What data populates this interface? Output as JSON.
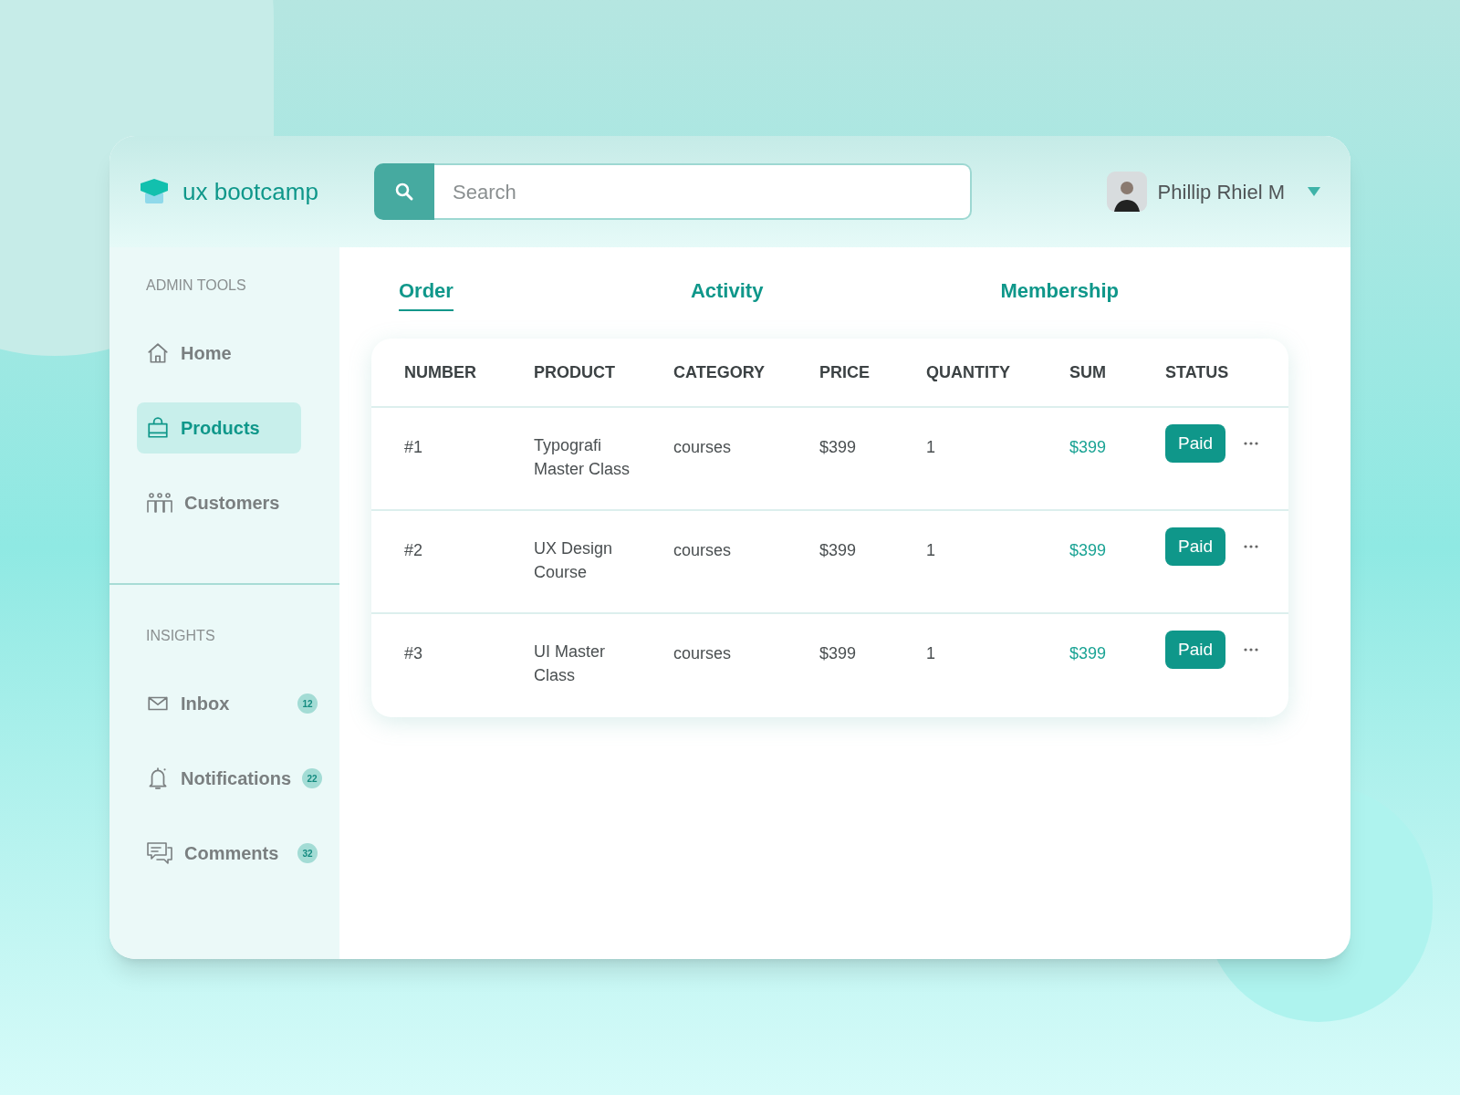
{
  "brand": {
    "name": "ux bootcamp"
  },
  "search": {
    "placeholder": "Search"
  },
  "user": {
    "name": "Phillip Rhiel M"
  },
  "sidebar": {
    "sections": [
      {
        "title": "ADMIN TOOLS",
        "items": [
          {
            "label": "Home",
            "kind": "home",
            "selected": false
          },
          {
            "label": "Products",
            "kind": "bag",
            "selected": true
          },
          {
            "label": "Customers",
            "kind": "people",
            "selected": false
          }
        ]
      },
      {
        "title": "INSIGHTS",
        "items": [
          {
            "label": "Inbox",
            "kind": "mail",
            "selected": false,
            "badge": "12"
          },
          {
            "label": "Notifications",
            "kind": "bell",
            "selected": false,
            "badge": "22"
          },
          {
            "label": "Comments",
            "kind": "chat",
            "selected": false,
            "badge": "32"
          }
        ]
      }
    ]
  },
  "tabs": [
    {
      "label": "Order",
      "selected": true
    },
    {
      "label": "Activity",
      "selected": false
    },
    {
      "label": "Membership",
      "selected": false
    }
  ],
  "table": {
    "columns": [
      "NUMBER",
      "PRODUCT",
      "CATEGORY",
      "PRICE",
      "QUANTITY",
      "SUM",
      "STATUS"
    ],
    "rows": [
      {
        "number": "#1",
        "product": "Typografi Master Class",
        "category": "courses",
        "price": "$399",
        "quantity": "1",
        "sum": "$399",
        "status": "Paid"
      },
      {
        "number": "#2",
        "product": "UX Design Course",
        "category": "courses",
        "price": "$399",
        "quantity": "1",
        "sum": "$399",
        "status": "Paid"
      },
      {
        "number": "#3",
        "product": "UI Master Class",
        "category": "courses",
        "price": "$399",
        "quantity": "1",
        "sum": "$399",
        "status": "Paid"
      }
    ]
  }
}
